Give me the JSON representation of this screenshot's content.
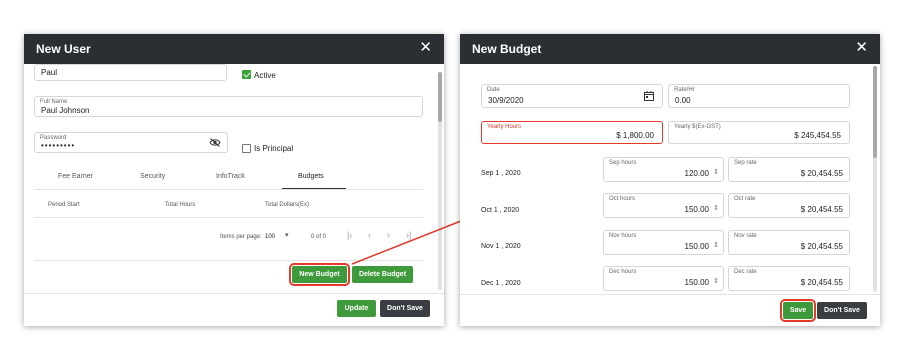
{
  "new_user": {
    "title": "New User",
    "close": "✕",
    "first_name": {
      "value": "Paul"
    },
    "active_label": "Active",
    "full_name": {
      "label": "Full Name",
      "value": "Paul Johnson"
    },
    "password": {
      "label": "Password",
      "value": "•••••••••"
    },
    "is_principal_label": "Is Principal",
    "tabs": [
      "Fee Earner",
      "Security",
      "InfoTrack",
      "Budgets"
    ],
    "columns": [
      "Period Start",
      "Total Hours",
      "Total Dollars(Ex)"
    ],
    "pager": {
      "items_per_page_label": "Items per page:",
      "page_size": "100",
      "range": "0 of 0"
    },
    "new_budget": "New Budget",
    "delete_budget": "Delete Budget",
    "update": "Update",
    "dont_save": "Don't Save"
  },
  "new_budget": {
    "title": "New Budget",
    "close": "✕",
    "date": {
      "label": "Date",
      "value": "30/9/2020"
    },
    "rate": {
      "label": "Rate/Hr",
      "value": "0.00"
    },
    "yearly_hours": {
      "label": "Yearly Hours",
      "value": "$ 1,800.00"
    },
    "yearly_dollars": {
      "label": "Yearly $(Ex-GST)",
      "value": "$ 245,454.55"
    },
    "months": [
      {
        "date": "Sep 1 , 2020",
        "hours_label": "Sep hours",
        "hours": "120.00",
        "rate_label": "Sep rate",
        "rate": "$ 20,454.55"
      },
      {
        "date": "Oct 1 , 2020",
        "hours_label": "Oct hours",
        "hours": "150.00",
        "rate_label": "Oct rate",
        "rate": "$ 20,454.55"
      },
      {
        "date": "Nov 1 , 2020",
        "hours_label": "Nov hours",
        "hours": "150.00",
        "rate_label": "Nov rate",
        "rate": "$ 20,454.55"
      },
      {
        "date": "Dec 1 , 2020",
        "hours_label": "Dec hours",
        "hours": "150.00",
        "rate_label": "Dec rate",
        "rate": "$ 20,454.55"
      }
    ],
    "save": "Save",
    "dont_save": "Don't Save"
  },
  "colors": {
    "highlight": "#e33a2b",
    "green": "#3f9a3b",
    "titlebar": "#2b2f33"
  }
}
